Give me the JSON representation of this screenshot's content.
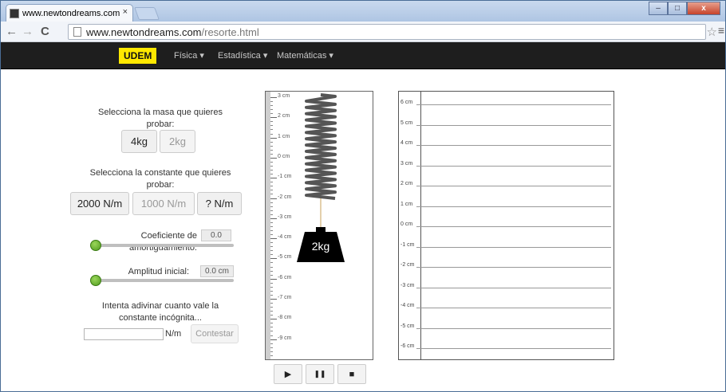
{
  "browser": {
    "tab_title": "www.newtondreams.com",
    "tab_close": "×",
    "url_host": "www.newtondreams.com",
    "url_path": "/resorte.html",
    "back_icon": "←",
    "forward_icon": "→",
    "reload_icon": "C",
    "star_icon": "☆",
    "menu_icon": "≡",
    "min_icon": "–",
    "max_icon": "□",
    "close_icon": "x"
  },
  "navbar": {
    "brand": "UDEM",
    "items": [
      "Física ▾",
      "Estadística ▾",
      "Matemáticas ▾"
    ]
  },
  "controls": {
    "mass_prompt": "Selecciona la masa que quieres probar:",
    "mass_options": [
      "4kg",
      "2kg"
    ],
    "mass_selected": "4kg",
    "constant_prompt": "Selecciona la constante que quieres probar:",
    "constant_options": [
      "2000 N/m",
      "1000 N/m",
      "? N/m"
    ],
    "damping_label": "Coeficiente de amortiguamiento:",
    "damping_value": "0.0",
    "damping_fraction": 0,
    "amplitude_label": "Amplitud inicial:",
    "amplitude_value": "0.0 cm",
    "amplitude_fraction": 0,
    "guess_prompt": "Intenta adivinar cuanto vale la constante incógnita...",
    "guess_unit": "N/m",
    "guess_placeholder": "",
    "answer_button": "Contestar"
  },
  "simulation": {
    "ruler_ticks": [
      "3 cm",
      "2 cm",
      "1 cm",
      "0 cm",
      "-1 cm",
      "-2 cm",
      "-3 cm",
      "-4 cm",
      "-5 cm",
      "-6 cm",
      "-7 cm",
      "-8 cm",
      "-9 cm"
    ],
    "weight_label": "2kg",
    "play_icon": "▶",
    "pause_icon": "❚❚",
    "stop_icon": "■"
  },
  "graph": {
    "ticks": [
      "6 cm",
      "5 cm",
      "4 cm",
      "3 cm",
      "2 cm",
      "1 cm",
      "0 cm",
      "-1 cm",
      "-2 cm",
      "-3 cm",
      "-4 cm",
      "-5 cm",
      "-6 cm"
    ]
  }
}
